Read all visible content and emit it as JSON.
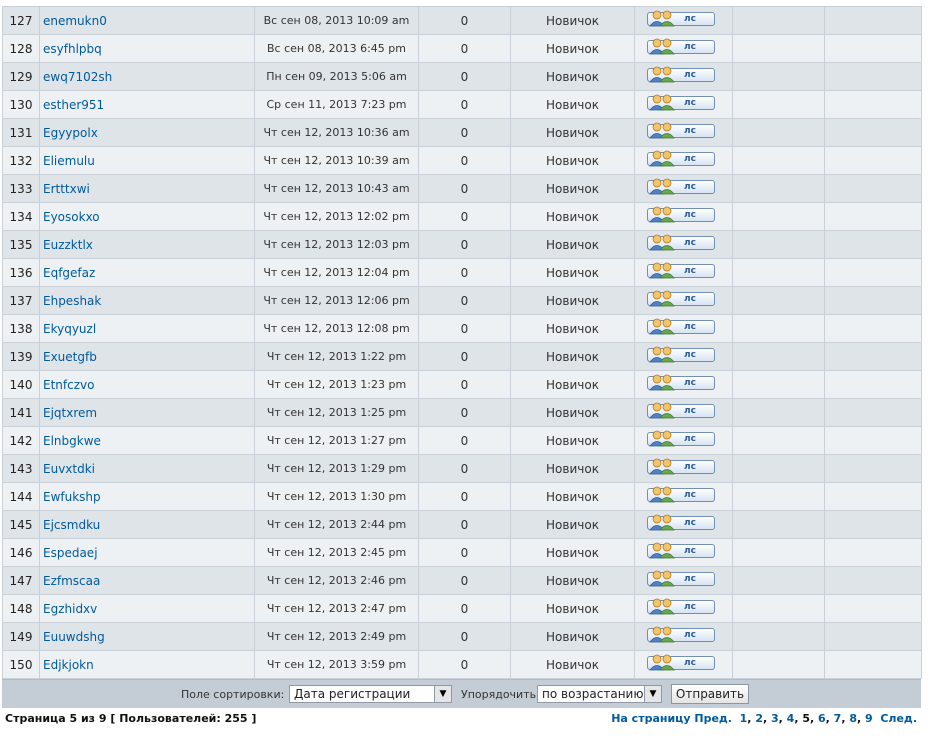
{
  "rows": [
    {
      "n": "127",
      "user": "enemukn0",
      "joined": "Вс сен 08, 2013 10:09 am",
      "posts": "0",
      "rank": "Новичок"
    },
    {
      "n": "128",
      "user": "esyfhlpbq",
      "joined": "Вс сен 08, 2013 6:45 pm",
      "posts": "0",
      "rank": "Новичок"
    },
    {
      "n": "129",
      "user": "ewq7102sh",
      "joined": "Пн сен 09, 2013 5:06 am",
      "posts": "0",
      "rank": "Новичок"
    },
    {
      "n": "130",
      "user": "esther951",
      "joined": "Ср сен 11, 2013 7:23 pm",
      "posts": "0",
      "rank": "Новичок"
    },
    {
      "n": "131",
      "user": "Egyypolx",
      "joined": "Чт сен 12, 2013 10:36 am",
      "posts": "0",
      "rank": "Новичок"
    },
    {
      "n": "132",
      "user": "Eliemulu",
      "joined": "Чт сен 12, 2013 10:39 am",
      "posts": "0",
      "rank": "Новичок"
    },
    {
      "n": "133",
      "user": "Ertttxwi",
      "joined": "Чт сен 12, 2013 10:43 am",
      "posts": "0",
      "rank": "Новичок"
    },
    {
      "n": "134",
      "user": "Eyosokxo",
      "joined": "Чт сен 12, 2013 12:02 pm",
      "posts": "0",
      "rank": "Новичок"
    },
    {
      "n": "135",
      "user": "Euzzktlx",
      "joined": "Чт сен 12, 2013 12:03 pm",
      "posts": "0",
      "rank": "Новичок"
    },
    {
      "n": "136",
      "user": "Eqfgefaz",
      "joined": "Чт сен 12, 2013 12:04 pm",
      "posts": "0",
      "rank": "Новичок"
    },
    {
      "n": "137",
      "user": "Ehpeshak",
      "joined": "Чт сен 12, 2013 12:06 pm",
      "posts": "0",
      "rank": "Новичок"
    },
    {
      "n": "138",
      "user": "Ekyqyuzl",
      "joined": "Чт сен 12, 2013 12:08 pm",
      "posts": "0",
      "rank": "Новичок"
    },
    {
      "n": "139",
      "user": "Exuetgfb",
      "joined": "Чт сен 12, 2013 1:22 pm",
      "posts": "0",
      "rank": "Новичок"
    },
    {
      "n": "140",
      "user": "Etnfczvo",
      "joined": "Чт сен 12, 2013 1:23 pm",
      "posts": "0",
      "rank": "Новичок"
    },
    {
      "n": "141",
      "user": "Ejqtxrem",
      "joined": "Чт сен 12, 2013 1:25 pm",
      "posts": "0",
      "rank": "Новичок"
    },
    {
      "n": "142",
      "user": "Elnbgkwe",
      "joined": "Чт сен 12, 2013 1:27 pm",
      "posts": "0",
      "rank": "Новичок"
    },
    {
      "n": "143",
      "user": "Euvxtdki",
      "joined": "Чт сен 12, 2013 1:29 pm",
      "posts": "0",
      "rank": "Новичок"
    },
    {
      "n": "144",
      "user": "Ewfukshp",
      "joined": "Чт сен 12, 2013 1:30 pm",
      "posts": "0",
      "rank": "Новичок"
    },
    {
      "n": "145",
      "user": "Ejcsmdku",
      "joined": "Чт сен 12, 2013 2:44 pm",
      "posts": "0",
      "rank": "Новичок"
    },
    {
      "n": "146",
      "user": "Espedaej",
      "joined": "Чт сен 12, 2013 2:45 pm",
      "posts": "0",
      "rank": "Новичок"
    },
    {
      "n": "147",
      "user": "Ezfmscaa",
      "joined": "Чт сен 12, 2013 2:46 pm",
      "posts": "0",
      "rank": "Новичок"
    },
    {
      "n": "148",
      "user": "Egzhidxv",
      "joined": "Чт сен 12, 2013 2:47 pm",
      "posts": "0",
      "rank": "Новичок"
    },
    {
      "n": "149",
      "user": "Euuwdshg",
      "joined": "Чт сен 12, 2013 2:49 pm",
      "posts": "0",
      "rank": "Новичок"
    },
    {
      "n": "150",
      "user": "Edjkjokn",
      "joined": "Чт сен 12, 2013 3:59 pm",
      "posts": "0",
      "rank": "Новичок"
    }
  ],
  "pm_label": "лс",
  "pm_icon": "two-users-icon",
  "sort": {
    "field_label": "Поле сортировки:",
    "field_value": "Дата регистрации",
    "order_label": "Упорядочить",
    "order_value": "по возрастанию",
    "submit_label": "Отправить"
  },
  "footer": {
    "page_info": "Страница 5 из 9 [ Пользователей: 255 ]",
    "goto_label": "На страницу",
    "prev_label": "Пред.",
    "pages": [
      "1",
      "2",
      "3",
      "4",
      "5",
      "6",
      "7",
      "8",
      "9"
    ],
    "current_page": "5",
    "next_label": "След."
  },
  "colors": {
    "row_dark": "#dfe4e9",
    "row_light": "#eef1f4",
    "link": "#005a9c",
    "sort_bar": "#c4cdd6"
  }
}
